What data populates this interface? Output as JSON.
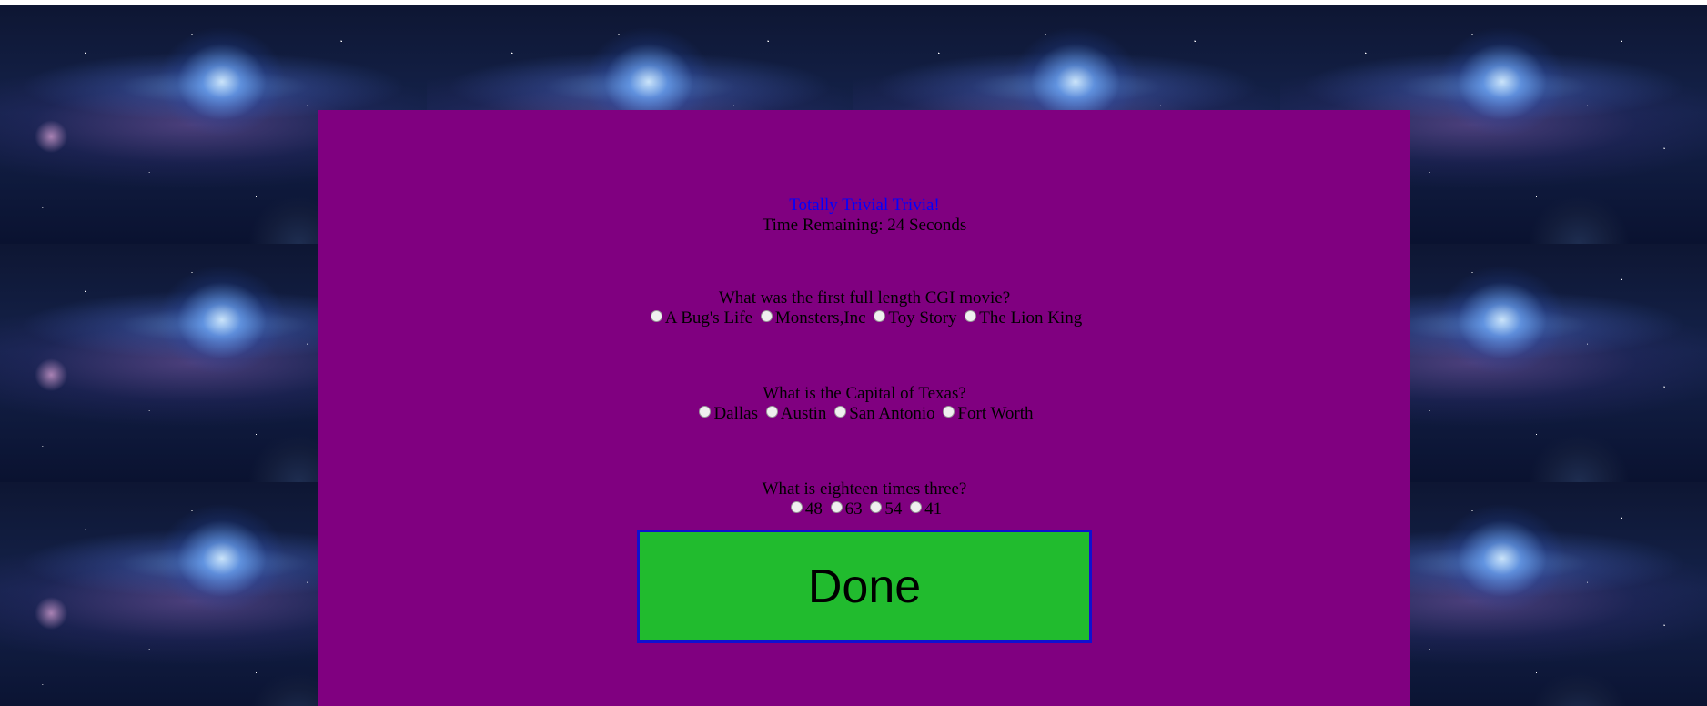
{
  "header": {
    "title": "Totally Trivial Trivia!",
    "timer_text": "Time Remaining: 24 Seconds"
  },
  "questions": [
    {
      "text": "What was the first full length CGI movie?",
      "options": [
        "A Bug's Life",
        "Monsters,Inc",
        "Toy Story",
        "The Lion King"
      ]
    },
    {
      "text": "What is the Capital of Texas?",
      "options": [
        "Dallas",
        "Austin",
        "San Antonio",
        "Fort Worth"
      ]
    },
    {
      "text": "What is eighteen times three?",
      "options": [
        "48",
        "63",
        "54",
        "41"
      ]
    }
  ],
  "done_button": {
    "label": "Done"
  },
  "colors": {
    "panel": "#800080",
    "title": "#0000ff",
    "button": "#21bb2e",
    "button_border": "#1010d0"
  }
}
